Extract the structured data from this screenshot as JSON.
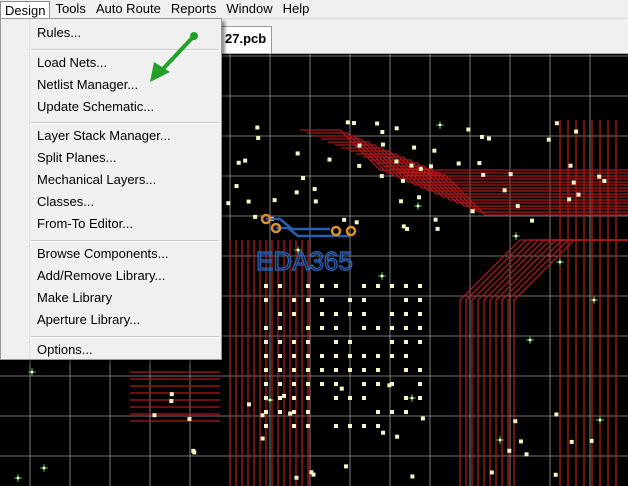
{
  "menubar": {
    "items": [
      "Design",
      "Tools",
      "Auto Route",
      "Reports",
      "Window",
      "Help"
    ],
    "active": "Design"
  },
  "document_tab": {
    "label": "27.pcb"
  },
  "design_menu": {
    "items": [
      "Rules...",
      "Load Nets...",
      "Netlist Manager...",
      "Update Schematic...",
      "Layer Stack Manager...",
      "Split Planes...",
      "Mechanical Layers...",
      "Classes...",
      "From-To Editor...",
      "Browse Components...",
      "Add/Remove Library...",
      "Make Library",
      "Aperture Library...",
      "Options..."
    ],
    "highlighted": "Netlist Manager..."
  },
  "watermark": {
    "text": "EDA365"
  },
  "colors": {
    "board_background": "#000000",
    "grid": "#9a9a9a",
    "traces": "#b01818",
    "pads": "#f4f4c4",
    "vias_green": "#30c030",
    "annotation_arrow": "#22a02a",
    "watermark": "#2a5fb0",
    "watermark_pads": "#e0902a"
  }
}
